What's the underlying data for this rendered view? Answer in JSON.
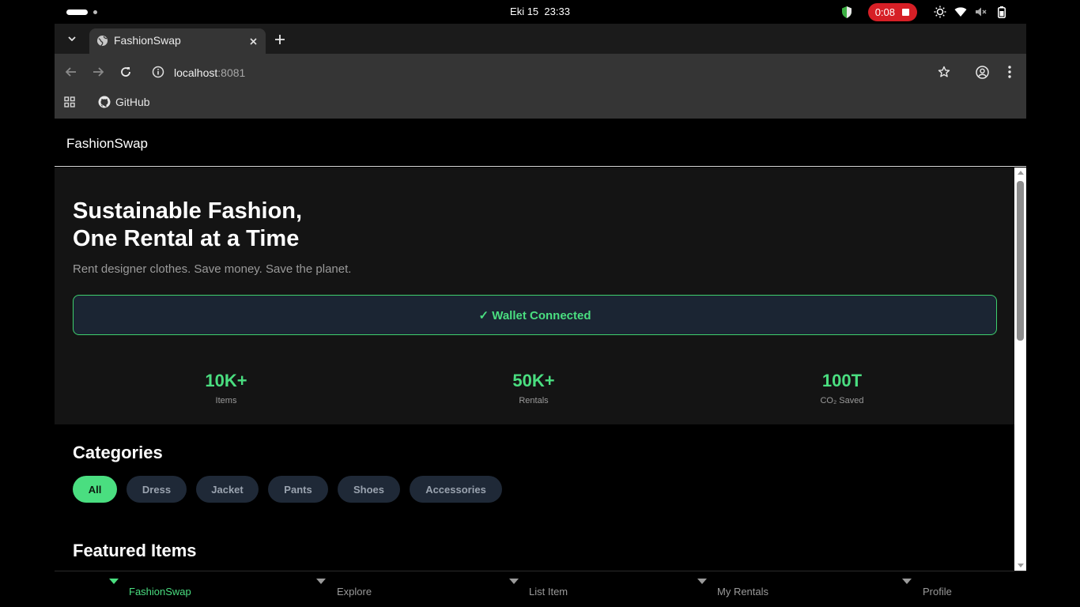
{
  "system": {
    "date": "Eki 15",
    "time": "23:33",
    "recording_time": "0:08"
  },
  "browser": {
    "tab_title": "FashionSwap",
    "url_host": "localhost",
    "url_port": ":8081",
    "bookmark": "GitHub"
  },
  "app": {
    "brand": "FashionSwap",
    "hero": {
      "title_line1": "Sustainable Fashion,",
      "title_line2": "One Rental at a Time",
      "subtitle": "Rent designer clothes. Save money. Save the planet.",
      "wallet_status": "✓ Wallet Connected"
    },
    "stats": [
      {
        "value": "10K+",
        "label": "Items"
      },
      {
        "value": "50K+",
        "label": "Rentals"
      },
      {
        "value": "100T",
        "label": "CO₂ Saved"
      }
    ],
    "categories_title": "Categories",
    "categories": [
      {
        "label": "All",
        "active": true
      },
      {
        "label": "Dress",
        "active": false
      },
      {
        "label": "Jacket",
        "active": false
      },
      {
        "label": "Pants",
        "active": false
      },
      {
        "label": "Shoes",
        "active": false
      },
      {
        "label": "Accessories",
        "active": false
      }
    ],
    "featured_title": "Featured Items",
    "bottom_nav": [
      {
        "label": "FashionSwap",
        "active": true
      },
      {
        "label": "Explore",
        "active": false
      },
      {
        "label": "List Item",
        "active": false
      },
      {
        "label": "My Rentals",
        "active": false
      },
      {
        "label": "Profile",
        "active": false
      }
    ]
  },
  "colors": {
    "accent": "#4ade80",
    "recording": "#d61f26",
    "wallet_bg": "#1b2533"
  }
}
